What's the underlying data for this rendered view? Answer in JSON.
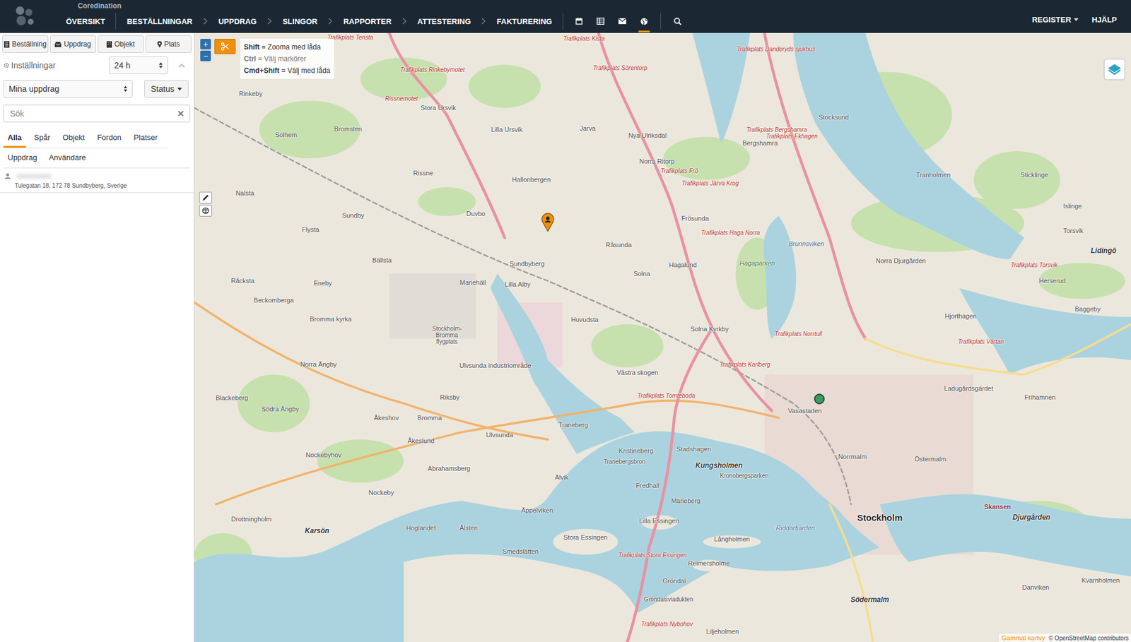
{
  "app": {
    "brand": "Coredination"
  },
  "nav": {
    "overview": "ÖVERSIKT",
    "steps": [
      "BESTÄLLNINGAR",
      "UPPDRAG",
      "SLINGOR",
      "RAPPORTER",
      "ATTESTERING",
      "FAKTURERING"
    ],
    "icon_tabs": [
      {
        "selected": false
      },
      {
        "selected": false
      },
      {
        "selected": false
      },
      {
        "selected": true
      }
    ],
    "right": [
      {
        "label": "REGISTER",
        "dropdown": true
      },
      {
        "label": "HJÄLP",
        "dropdown": false
      }
    ]
  },
  "sidebar": {
    "create_buttons": [
      "Beställning",
      "Uppdrag",
      "Objekt",
      "Plats"
    ],
    "settings": {
      "label": "Inställningar",
      "period": "24 h"
    },
    "filter": {
      "value": "Mina uppdrag"
    },
    "status_button": "Status",
    "search": {
      "placeholder": "Sök"
    },
    "tabs": [
      {
        "label": "Alla",
        "selected": true
      },
      {
        "label": "Spår",
        "selected": false
      },
      {
        "label": "Objekt",
        "selected": false
      },
      {
        "label": "Fordon",
        "selected": false
      },
      {
        "label": "Platser",
        "selected": false
      }
    ],
    "tabs2": [
      {
        "label": "Uppdrag",
        "selected": false
      },
      {
        "label": "Användare",
        "selected": false
      }
    ],
    "items": [
      {
        "address": "Tulegatan 18, 172 78 Sundbyberg, Sverige"
      }
    ]
  },
  "map": {
    "zoom": [
      "+",
      "−"
    ],
    "help": [
      {
        "key": "Shift",
        "text": "= Zooma med låda",
        "muted": false
      },
      {
        "key": "Ctrl",
        "text": "= Välj markörer",
        "muted": true
      },
      {
        "key": "Cmd+Shift",
        "text": "= Välj med låda",
        "muted": false
      }
    ],
    "labels": [
      {
        "text": "Rinkeby",
        "kind": "place"
      },
      {
        "text": "Stora Ursvik",
        "kind": "place"
      },
      {
        "text": "Lilla Ursvik",
        "kind": "place"
      },
      {
        "text": "Jarva",
        "kind": "place"
      },
      {
        "text": "Nya Ulriksdal",
        "kind": "place"
      },
      {
        "text": "Bromsten",
        "kind": "place"
      },
      {
        "text": "Solhem",
        "kind": "place"
      },
      {
        "text": "Rissne",
        "kind": "place"
      },
      {
        "text": "Hallonbergen",
        "kind": "place"
      },
      {
        "text": "Norra Ritorp",
        "kind": "place"
      },
      {
        "text": "Stocksund",
        "kind": "place"
      },
      {
        "text": "Tranholmen",
        "kind": "place"
      },
      {
        "text": "Bergshamra",
        "kind": "place"
      },
      {
        "text": "Nalsta",
        "kind": "place"
      },
      {
        "text": "Sundby",
        "kind": "place"
      },
      {
        "text": "Duvbo",
        "kind": "place"
      },
      {
        "text": "Frösunda",
        "kind": "place"
      },
      {
        "text": "Råsunda",
        "kind": "place"
      },
      {
        "text": "Solna",
        "kind": "place"
      },
      {
        "text": "Hagalund",
        "kind": "place"
      },
      {
        "text": "Flysta",
        "kind": "place"
      },
      {
        "text": "Bällsta",
        "kind": "place"
      },
      {
        "text": "Sundbyberg",
        "kind": "place"
      },
      {
        "text": "Lilla Alby",
        "kind": "place"
      },
      {
        "text": "Mariehäll",
        "kind": "place"
      },
      {
        "text": "Råcksta",
        "kind": "place"
      },
      {
        "text": "Eneby",
        "kind": "place"
      },
      {
        "text": "Beckomberga",
        "kind": "place"
      },
      {
        "text": "Bromma kyrka",
        "kind": "place"
      },
      {
        "text": "Stockholm-Bromma flygplats",
        "kind": "airport"
      },
      {
        "text": "Huvudsta",
        "kind": "place"
      },
      {
        "text": "Solna Kyrkby",
        "kind": "place"
      },
      {
        "text": "Norra Djurgården",
        "kind": "place"
      },
      {
        "text": "Hjorthagen",
        "kind": "place"
      },
      {
        "text": "Ladugårdsgärdet",
        "kind": "place"
      },
      {
        "text": "Vasastaden",
        "kind": "place"
      },
      {
        "text": "Västra skogen",
        "kind": "place"
      },
      {
        "text": "Ulvsunda industriområde",
        "kind": "place"
      },
      {
        "text": "Norra Ängby",
        "kind": "place"
      },
      {
        "text": "Blackeberg",
        "kind": "place"
      },
      {
        "text": "Riksby",
        "kind": "place"
      },
      {
        "text": "Södra Ängby",
        "kind": "place"
      },
      {
        "text": "Åkeshov",
        "kind": "place"
      },
      {
        "text": "Bromma",
        "kind": "place"
      },
      {
        "text": "Ulvsunda",
        "kind": "place"
      },
      {
        "text": "Traneberg",
        "kind": "place"
      },
      {
        "text": "Kristineberg",
        "kind": "place"
      },
      {
        "text": "Stadshagen",
        "kind": "place"
      },
      {
        "text": "Kungsholmen",
        "kind": "district"
      },
      {
        "text": "Norrmalm",
        "kind": "place"
      },
      {
        "text": "Östermalm",
        "kind": "place"
      },
      {
        "text": "Åkeslund",
        "kind": "place"
      },
      {
        "text": "Nockebyhov",
        "kind": "place"
      },
      {
        "text": "Abrahamsberg",
        "kind": "place"
      },
      {
        "text": "Tranebergsbron",
        "kind": "small"
      },
      {
        "text": "Fredhall",
        "kind": "place"
      },
      {
        "text": "Marieberg",
        "kind": "place"
      },
      {
        "text": "Alvik",
        "kind": "place"
      },
      {
        "text": "Kronobergsparken",
        "kind": "small"
      },
      {
        "text": "Nockeby",
        "kind": "place"
      },
      {
        "text": "Äppelviken",
        "kind": "place"
      },
      {
        "text": "Stockholm",
        "kind": "city"
      },
      {
        "text": "Skansen",
        "kind": "poi"
      },
      {
        "text": "Djurgården",
        "kind": "district"
      },
      {
        "text": "Drottningholm",
        "kind": "place"
      },
      {
        "text": "Karsön",
        "kind": "district"
      },
      {
        "text": "Hoglandet",
        "kind": "place"
      },
      {
        "text": "Ålsten",
        "kind": "place"
      },
      {
        "text": "Smedslätten",
        "kind": "place"
      },
      {
        "text": "Lilla Essingen",
        "kind": "place"
      },
      {
        "text": "Stora Essingen",
        "kind": "place"
      },
      {
        "text": "Långholmen",
        "kind": "place"
      },
      {
        "text": "Riddarfjärden",
        "kind": "water"
      },
      {
        "text": "Reimersholme",
        "kind": "place"
      },
      {
        "text": "Södermalm",
        "kind": "district"
      },
      {
        "text": "Gröndal",
        "kind": "place"
      },
      {
        "text": "Gröndalsviadukten",
        "kind": "small"
      },
      {
        "text": "Liljeholmen",
        "kind": "place"
      },
      {
        "text": "Danviken",
        "kind": "place"
      },
      {
        "text": "Kvarnholmen",
        "kind": "place"
      },
      {
        "text": "Lidingö",
        "kind": "district"
      },
      {
        "text": "Torsvik",
        "kind": "place"
      },
      {
        "text": "Islinge",
        "kind": "place"
      },
      {
        "text": "Sticklinge",
        "kind": "place"
      },
      {
        "text": "Baggeby",
        "kind": "place"
      },
      {
        "text": "Herserud",
        "kind": "place"
      },
      {
        "text": "Frihamnen",
        "kind": "place"
      },
      {
        "text": "Brunnsviken",
        "kind": "water"
      },
      {
        "text": "Hagaparken",
        "kind": "park"
      },
      {
        "text": "Trafikplats Tensta",
        "kind": "traffic"
      },
      {
        "text": "Trafikplats Kista",
        "kind": "traffic"
      },
      {
        "text": "Trafikplats Danderyds sjukhus",
        "kind": "traffic"
      },
      {
        "text": "Trafikplats Rinkebymotet",
        "kind": "traffic"
      },
      {
        "text": "Trafikplats Sörentorp",
        "kind": "traffic"
      },
      {
        "text": "Rissnemotet",
        "kind": "traffic"
      },
      {
        "text": "Trafikplats Frö",
        "kind": "traffic"
      },
      {
        "text": "Trafikplats Haga Norra",
        "kind": "traffic"
      },
      {
        "text": "Trafikplats Ekhagen",
        "kind": "traffic"
      },
      {
        "text": "Trafikplats Norrtull",
        "kind": "traffic"
      },
      {
        "text": "Trafikplats Karlberg",
        "kind": "traffic"
      },
      {
        "text": "Trafikplats Tomteboda",
        "kind": "traffic"
      },
      {
        "text": "Trafikplats Stora Essingen",
        "kind": "traffic"
      },
      {
        "text": "Trafikplats Värtan",
        "kind": "traffic"
      },
      {
        "text": "Trafikplats Torsvik",
        "kind": "traffic"
      },
      {
        "text": "Trafikplats Nybohov",
        "kind": "traffic"
      },
      {
        "text": "Trafikplats Bergshamra",
        "kind": "traffic"
      },
      {
        "text": "Trafikplats Järva Krog",
        "kind": "traffic"
      }
    ],
    "markers": [
      {
        "kind": "pin",
        "color": "#f0900a"
      },
      {
        "kind": "dot",
        "color": "#3c9a5f"
      }
    ],
    "footer": {
      "old_view": "Gammal kartvy",
      "attribution": "© OpenStreetMap contributors"
    }
  }
}
